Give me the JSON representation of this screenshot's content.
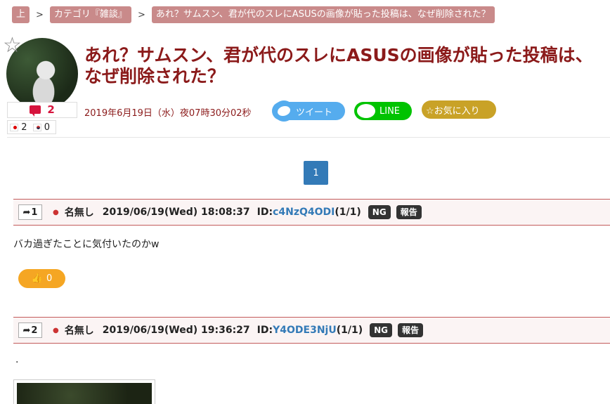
{
  "breadcrumb": {
    "top": "上",
    "separator": ">",
    "category": "カテゴリ『雑談』",
    "current": "あれ？サムスン、君が代のスレにASUSの画像が貼った投稿は、なぜ削除された？"
  },
  "thread": {
    "title": "あれ？サムスン、君が代のスレにASUSの画像が貼った投稿は、なぜ削除された？",
    "comment_count": "2",
    "flag_jp_count": "2",
    "flag_kr_count": "0",
    "date": "2019年6月19日（水）夜07時30分02秒"
  },
  "share": {
    "tweet_label": "ツイート",
    "line_label": "LINE",
    "favorite_label": "☆お気に入り"
  },
  "pagination": {
    "current": "1"
  },
  "posts": [
    {
      "number": "1",
      "name": "名無し",
      "date": "2019/06/19(Wed) 18:08:37",
      "id_label": "ID:",
      "id": "c4NzQ4ODI",
      "id_count": "(1/1)",
      "ng_label": "NG",
      "report_label": "報告",
      "body": "バカ過ぎたことに気付いたのかw",
      "likes": "0"
    },
    {
      "number": "2",
      "name": "名無し",
      "date": "2019/06/19(Wed) 19:36:27",
      "id_label": "ID:",
      "id": "Y4ODE3NjU",
      "id_count": "(1/1)",
      "ng_label": "NG",
      "report_label": "報告",
      "body": "."
    }
  ],
  "colors": {
    "title": "#8b1a1a",
    "crumb": "#c98a8a",
    "tweet": "#55acee",
    "line": "#00c300",
    "favorite": "#c9a227",
    "pagination": "#337ab7",
    "like": "#f5a623",
    "post_border": "#c35b5b"
  }
}
